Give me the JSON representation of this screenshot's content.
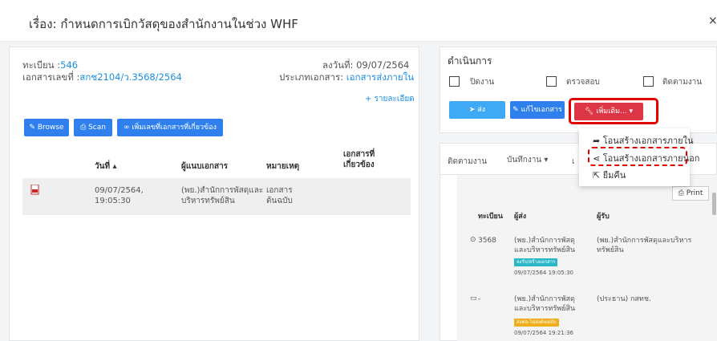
{
  "modal": {
    "title": "เรื่อง: กำหนดการเบิกวัสดุของสำนักงานในช่วง WHF",
    "close": "×"
  },
  "doc": {
    "reg_label": "ทะเบียน :",
    "reg_value": "546",
    "docno_label": "เอกสารเลขที่ :",
    "docno_value": "สกช2104/ว.3568/2564",
    "date_label": "ลงวันที่:",
    "date_value": "09/07/2564",
    "type_label": "ประเภทเอกสาร:",
    "type_value": "เอกสารส่งภายใน",
    "detail_link": "+ รายละเอียด"
  },
  "toolbar": {
    "browse": "Browse",
    "scan": "Scan",
    "add_related": "เพิ่มเลขที่เอกสารที่เกี่ยวข้อง"
  },
  "files_table": {
    "headers": {
      "date": "วันที่",
      "author": "ผู้แนบเอกสาร",
      "note": "หมายเหตุ",
      "related_1": "เอกสารที่",
      "related_2": "เกี่ยวข้อง"
    },
    "rows": [
      {
        "date_1": "09/07/2564,",
        "date_2": "19:05:30",
        "author_1": "(พย.)สำนักการพัสดุและ",
        "author_2": "บริหารทรัพย์สิน",
        "note_1": "เอกสาร",
        "note_2": "ต้นฉบับ"
      }
    ]
  },
  "action": {
    "title": "ดำเนินการ",
    "checks": [
      "ปิดงาน",
      "ตรวจสอบ",
      "ติดตามงาน"
    ],
    "send": "ส่ง",
    "edit": "แก้ไขเอกสาร",
    "more": "เพิ่มเติม..."
  },
  "dropdown": {
    "items": [
      "โอนสร้างเอกสารภายใน",
      "โอนสร้างเอกสารภายนอก",
      "ยืมคืน"
    ]
  },
  "tracking": {
    "tabs": [
      "ติดตามงาน",
      "บันทึกงาน",
      "เ"
    ],
    "print": "Print",
    "headers": {
      "reg": "ทะเบียน",
      "sender": "ผู้ส่ง",
      "receiver": "ผู้รับ"
    },
    "rows": [
      {
        "reg": "3568",
        "sender_1": "(พย.)สำนักการพัสดุ",
        "sender_2": "และบริหารทรัพย์สิน",
        "badge": "ลงรับ/สร้างเอกสาร",
        "time": "09/07/2564 19:05:30",
        "receiver_1": "(พย.)สำนักการพัสดุและบริหาร",
        "receiver_2": "ทรัพย์สิน"
      },
      {
        "reg": "-",
        "sender_1": "(พย.)สำนักการพัสดุ",
        "sender_2": "และบริหารทรัพย์สิน",
        "badge": "ส่งต่อ-ไม่ส่งต้นฉบับ",
        "time": "09/07/2564 19:21:36",
        "receiver_1": "(ประธาน) กสทช.",
        "receiver_2": ""
      }
    ]
  },
  "colors": {
    "accent": "#1d8fe1",
    "button": "#2f80ed",
    "danger": "#dc3545",
    "highlight": "#e00000"
  }
}
